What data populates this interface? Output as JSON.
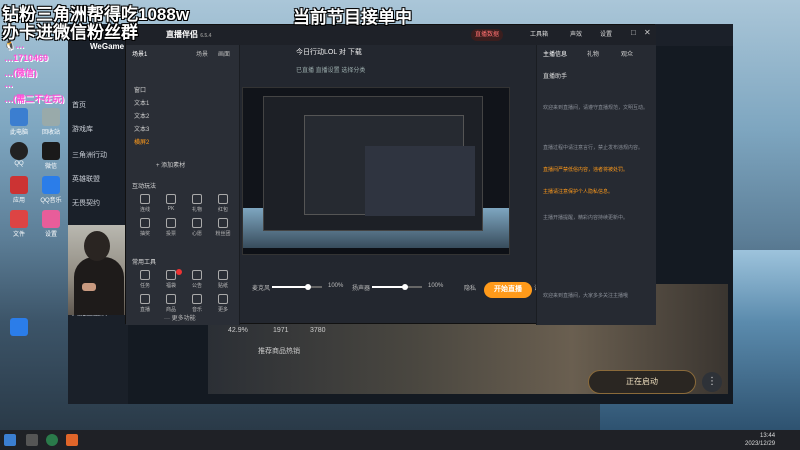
{
  "overlay": {
    "title_line1": "钻粉三角洲帮得吃1088w",
    "title_line2": "办卡进微信粉丝群",
    "right_text": "当前节目接单中",
    "qq_lines": [
      "🐧…",
      "…1710469",
      "…(微信)",
      "…",
      "…(需二不在玩)"
    ]
  },
  "desktop_icons": [
    {
      "name": "此电脑"
    },
    {
      "name": "回收站"
    },
    {
      "name": "QQ"
    },
    {
      "name": "微信"
    },
    {
      "name": "应用"
    },
    {
      "name": "QQ音乐"
    },
    {
      "name": "文件"
    },
    {
      "name": "设置"
    }
  ],
  "wegame": {
    "logo": "WeGame",
    "side_items": [
      "首页",
      "游戏库",
      "三角洲行动",
      "英雄联盟",
      "无畏契约",
      "大魔王战队"
    ],
    "launch_label": "正在启动",
    "menu_label": "⋮",
    "stats": [
      "42.9%",
      "1971",
      "3780"
    ],
    "bottom_text": "推荐商品热销"
  },
  "stream": {
    "logo": "直播伴侣",
    "version": "6.5.4",
    "room_title": "今日行动LOL 对 下载",
    "room_info": "已直播 直播设置 选择分类",
    "header_chips": [
      "直播数据",
      "工具箱",
      "声效",
      "设置"
    ],
    "left_tabs": [
      "场景1",
      "场景",
      "画面"
    ],
    "scenes": [
      "窗口",
      "文本1",
      "文本2",
      "文本3",
      "横屏2"
    ],
    "add_source": "+ 添加素材",
    "section1": "互动玩法",
    "section2": "常用工具",
    "tools1": [
      "连线",
      "PK",
      "礼物",
      "红包",
      "抽奖",
      "投票",
      "心愿",
      "粉丝团"
    ],
    "tools2": [
      "任务",
      "福袋",
      "公告",
      "贴纸",
      "直播",
      "商品",
      "音乐",
      "更多"
    ],
    "more_tools": "··· 更多功能",
    "mic_label": "麦克风",
    "mic_value": "100%",
    "speaker_label": "扬声器",
    "speaker_value": "100%",
    "go_live": "开始直播",
    "bottom_labels": [
      "隐私",
      "PK",
      "连线",
      "设置"
    ],
    "right_tabs": [
      "主播信息",
      "礼物",
      "观众"
    ],
    "right_title": "直播助手",
    "right_texts": [
      "欢迎来到直播间，请遵守直播规范，文明互动。",
      "直播过程中请注意言行，禁止发布违规内容。",
      "主播开播提醒，精彩内容持续更新中。"
    ],
    "right_orange": [
      "直播间严禁低俗内容，违者将被处罚。",
      "主播请注意保护个人隐私信息。"
    ],
    "right_footer": "欢迎来到直播间，大家多多关注主播哦"
  },
  "mic_level": 0.72,
  "speaker_level": 0.65,
  "taskbar": {
    "time": "13:44",
    "date": "2023/12/29"
  },
  "colors": {
    "accent": "#ff9a1a",
    "overlay_pink": "#ff4fd8"
  }
}
